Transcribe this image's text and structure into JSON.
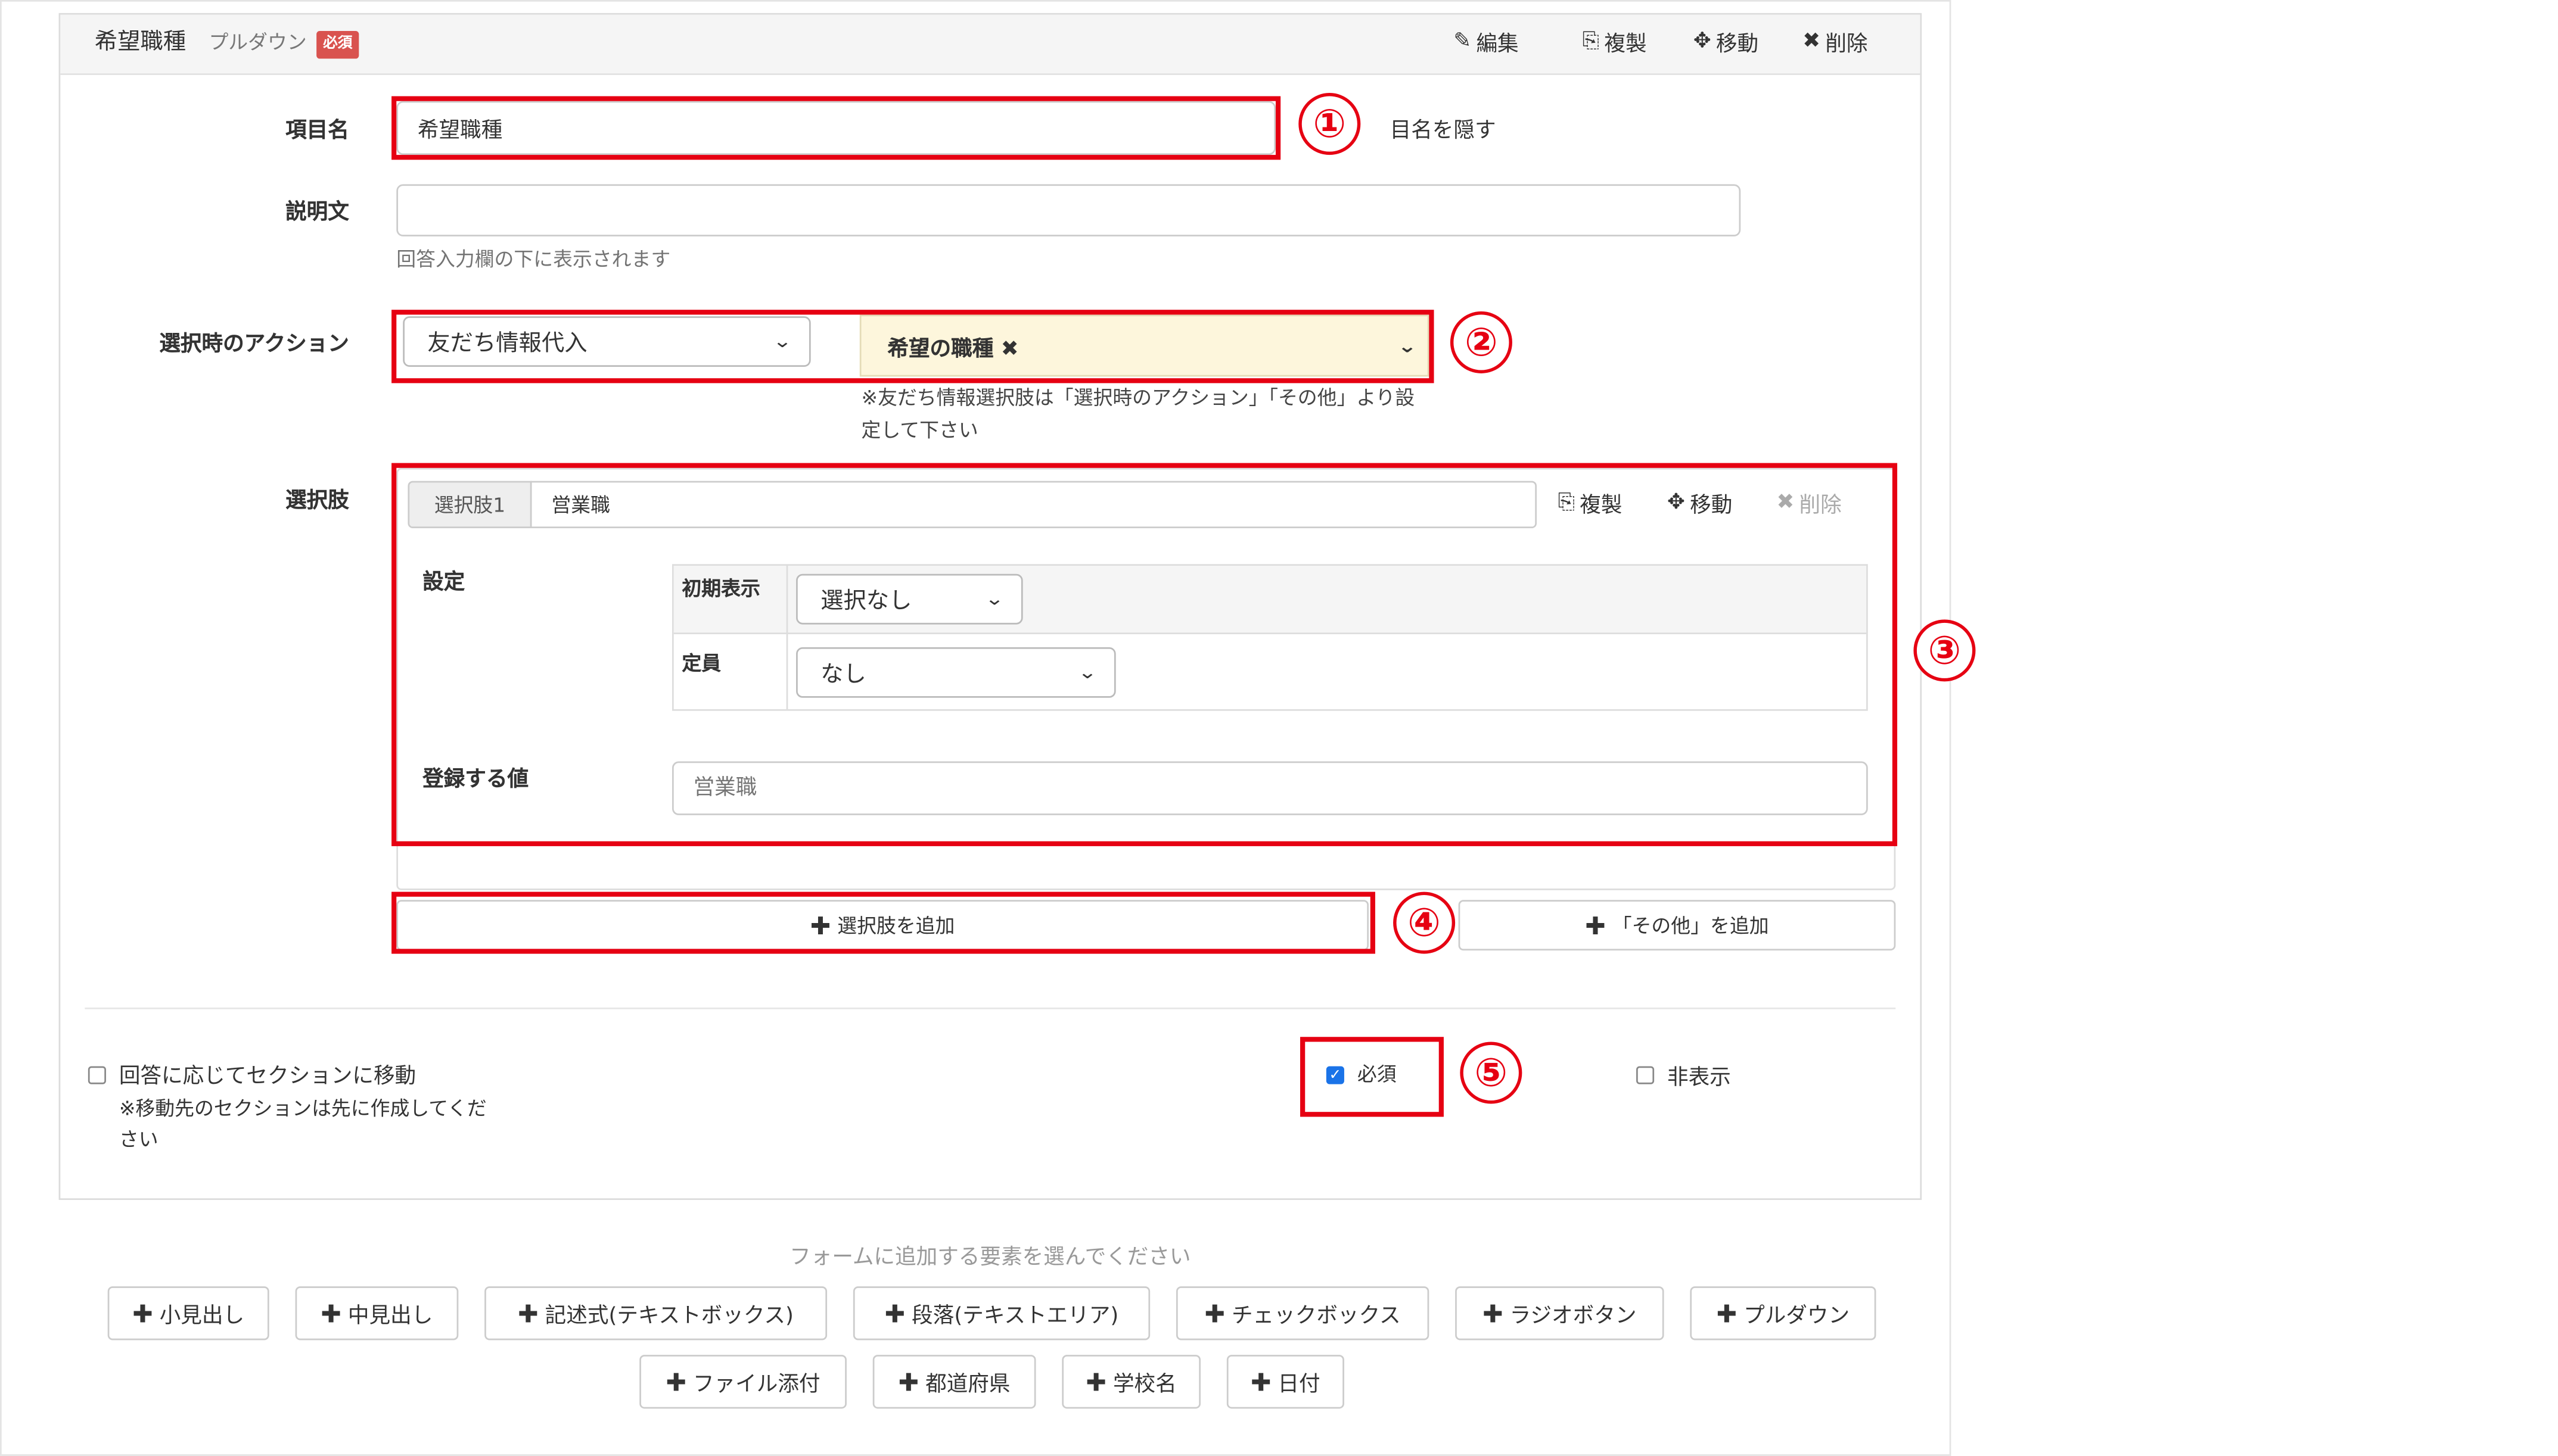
{
  "card": {
    "title": "希望職種",
    "subtitle": "プルダウン",
    "required_badge": "必須",
    "actions": {
      "edit": "編集",
      "copy": "複製",
      "move": "移動",
      "delete": "削除"
    }
  },
  "item_name": {
    "label": "項目名",
    "value": "希望職種",
    "hide_label_text": "目名を隠す"
  },
  "description": {
    "label": "説明文",
    "value": "",
    "help": "回答入力欄の下に表示されます"
  },
  "action": {
    "label": "選択時のアクション",
    "select_value": "友だち情報代入",
    "tag_value": "希望の職種 ✖",
    "note_line1": "※友だち情報選択肢は「選択時のアクション」「その他」より設",
    "note_line2": "定して下さい"
  },
  "choices": {
    "label": "選択肢",
    "choice1": {
      "tag": "選択肢1",
      "value": "営業職",
      "copy": "複製",
      "move": "移動",
      "delete": "削除",
      "settings_label": "設定",
      "initial_display_label": "初期表示",
      "initial_display_value": "選択なし",
      "capacity_label": "定員",
      "capacity_value": "なし",
      "register_label": "登録する値",
      "register_placeholder": "営業職"
    }
  },
  "add_choice_button": "選択肢を追加",
  "add_other_button": "「その他」を追加",
  "bottom": {
    "section_move_label": "回答に応じてセクションに移動",
    "section_note_line1": "※移動先のセクションは先に作成してくだ",
    "section_note_line2": "さい",
    "required_label": "必須",
    "hidden_label": "非表示"
  },
  "add_elements": {
    "prompt": "フォームに追加する要素を選んでください",
    "row1": [
      "小見出し",
      "中見出し",
      "記述式(テキストボックス)",
      "段落(テキストエリア)",
      "チェックボックス",
      "ラジオボタン",
      "プルダウン"
    ],
    "row2": [
      "ファイル添付",
      "都道府県",
      "学校名",
      "日付"
    ]
  },
  "annotations": [
    "①",
    "②",
    "③",
    "④",
    "⑤"
  ],
  "colors": {
    "annotation_red": "#e60012",
    "required_badge": "#d9534f",
    "tag_bg": "#fdf6dc",
    "checkbox_blue": "#1a73e8"
  }
}
